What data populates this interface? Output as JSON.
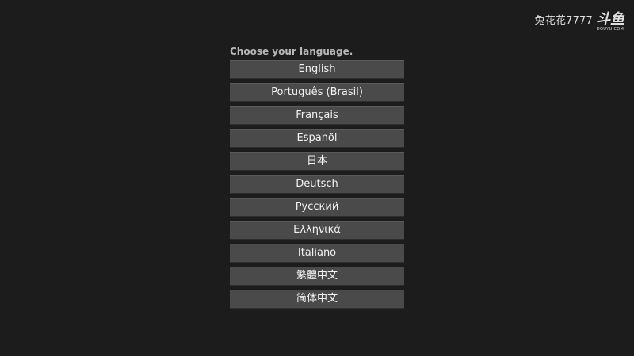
{
  "watermark": {
    "user": "兔花花7777",
    "logo_main": "斗鱼",
    "logo_sub": "DOUYU.COM"
  },
  "prompt": "Choose your language.",
  "languages": [
    "English",
    "Português (Brasil)",
    "Français",
    "Espanõl",
    "日本",
    "Deutsch",
    "Русский",
    "Ελληνικά",
    "Italiano",
    "繁體中文",
    "简体中文"
  ],
  "colors": {
    "background": "#1c1c1c",
    "button": "#4a4a4a",
    "prompt_text": "#b8b8b8",
    "button_text": "#f2f2f2"
  }
}
